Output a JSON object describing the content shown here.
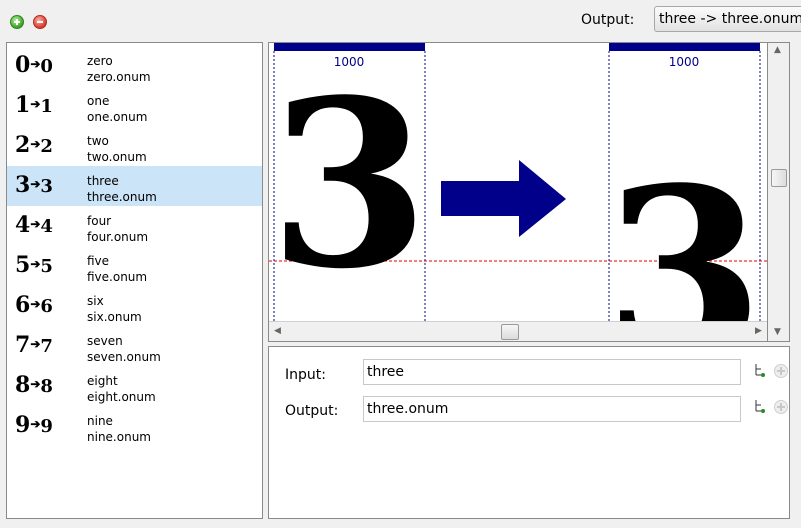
{
  "toolbar": {
    "output_label": "Output:",
    "output_value": "three -> three.onum"
  },
  "glyph_list": [
    {
      "digit": "0",
      "input": "zero",
      "output": "zero.onum"
    },
    {
      "digit": "1",
      "input": "one",
      "output": "one.onum"
    },
    {
      "digit": "2",
      "input": "two",
      "output": "two.onum"
    },
    {
      "digit": "3",
      "input": "three",
      "output": "three.onum",
      "selected": true
    },
    {
      "digit": "4",
      "input": "four",
      "output": "four.onum"
    },
    {
      "digit": "5",
      "input": "five",
      "output": "five.onum"
    },
    {
      "digit": "6",
      "input": "six",
      "output": "six.onum"
    },
    {
      "digit": "7",
      "input": "seven",
      "output": "seven.onum"
    },
    {
      "digit": "8",
      "input": "eight",
      "output": "eight.onum"
    },
    {
      "digit": "9",
      "input": "nine",
      "output": "nine.onum"
    }
  ],
  "preview": {
    "left_advance": "1000",
    "right_advance": "1000",
    "glyph_char": "3",
    "arrow_color": "#00008b"
  },
  "form": {
    "input_label": "Input:",
    "input_value": "three",
    "output_label": "Output:",
    "output_value": "three.onum"
  },
  "colors": {
    "selection": "#cce4f7",
    "header_bar": "#00008b",
    "guide_line": "#e00000"
  }
}
